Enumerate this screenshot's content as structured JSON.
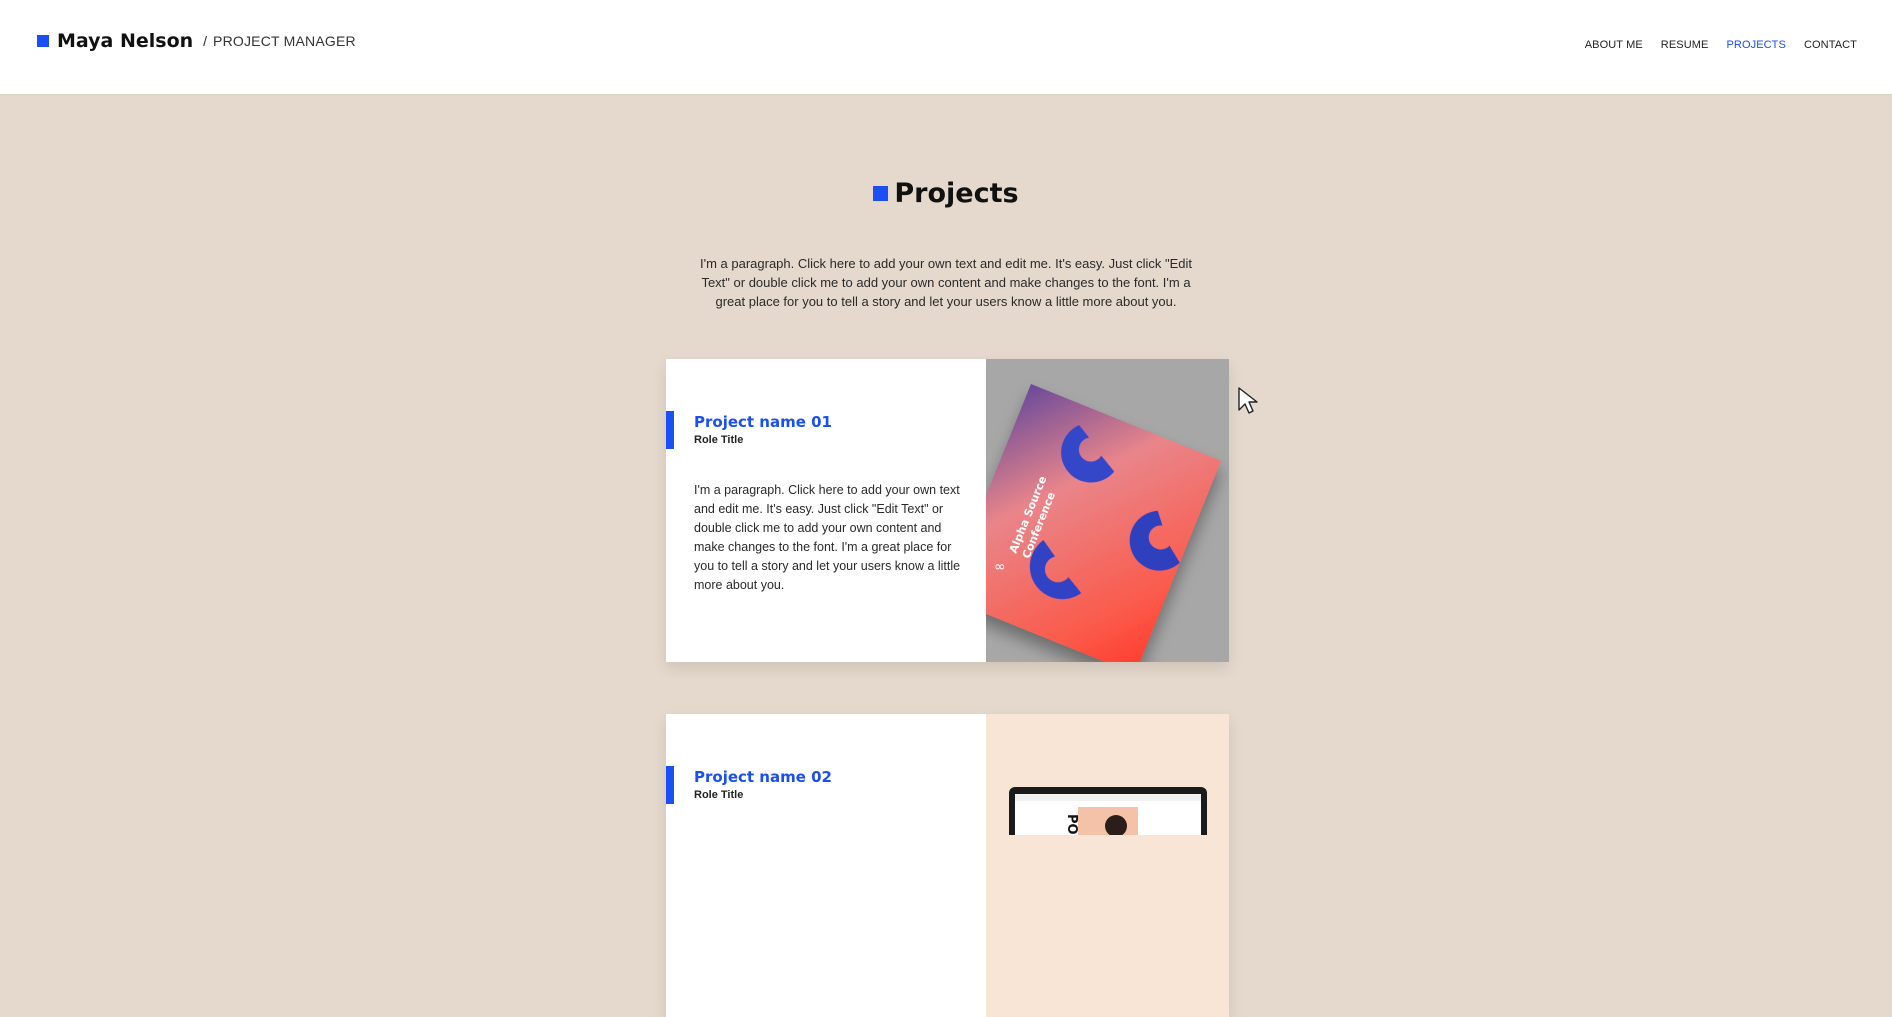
{
  "header": {
    "brand_name": "Maya Nelson",
    "separator": "/",
    "brand_role": "PROJECT MANAGER",
    "nav": [
      {
        "label": "ABOUT ME",
        "active": false
      },
      {
        "label": "RESUME",
        "active": false
      },
      {
        "label": "PROJECTS",
        "active": true
      },
      {
        "label": "CONTACT",
        "active": false
      }
    ]
  },
  "section": {
    "title": "Projects",
    "intro": "I'm a paragraph. Click here to add your own text and edit me. It's easy. Just click \"Edit Text\" or double click me to add your own content and make changes to the font. I'm a great place for you to tell a story and let your users know a little more about you."
  },
  "projects": [
    {
      "name": "Project name 01",
      "role": "Role Title",
      "description": "I'm a paragraph. Click here to add your own text and edit me. It's easy. Just click \"Edit Text\" or double click me to add your own content and make changes to the font. I'm a great place for you to tell a story and let your users know a little more about you.",
      "poster_title_line1": "Alpha Source",
      "poster_title_line2": "Conference"
    },
    {
      "name": "Project name 02",
      "role": "Role Title",
      "screen_text": "POP"
    }
  ],
  "colors": {
    "accent": "#1a4ff3",
    "background": "#e5d9cd",
    "header_bg": "#ffffff"
  }
}
